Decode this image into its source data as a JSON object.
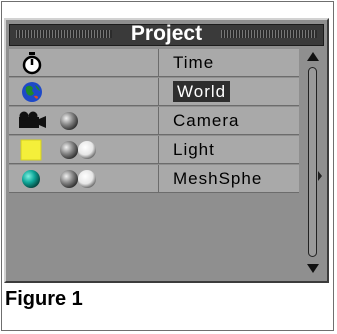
{
  "panel": {
    "title": "Project"
  },
  "rows": [
    {
      "label": "Time",
      "icons": [
        "stopwatch-icon"
      ],
      "selected": false
    },
    {
      "label": "World",
      "icons": [
        "globe-icon"
      ],
      "selected": true
    },
    {
      "label": "Camera",
      "icons": [
        "camera-icon",
        "gray-sphere-icon"
      ],
      "selected": false
    },
    {
      "label": "Light",
      "icons": [
        "yellow-square-light-icon",
        "gray-sphere-icon",
        "white-sphere-icon"
      ],
      "selected": false
    },
    {
      "label": "MeshSphe",
      "icons": [
        "teal-sphere-icon",
        "gray-sphere-icon",
        "white-sphere-icon"
      ],
      "selected": false
    }
  ],
  "caption": "Figure 1",
  "colors": {
    "panel_bg": "#8f8f8f",
    "row_bg": "#a9a9a9",
    "titlebar_bg": "#3a3a3a",
    "selection_bg": "#2e2e2e"
  }
}
